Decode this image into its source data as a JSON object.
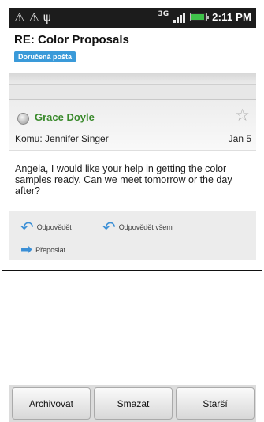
{
  "status_bar": {
    "left_icons": [
      "warning-icon",
      "warning-icon",
      "usb-icon"
    ],
    "network": "3G",
    "time": "2:11 PM",
    "battery_level": 0.8
  },
  "header": {
    "subject": "RE: Color Proposals",
    "folder": "Doručená pošta"
  },
  "message": {
    "sender": "Grace Doyle",
    "recipient": "Komu: Jennifer Singer",
    "date": "Jan 5",
    "body": "Angela, I would like your help in getting the color samples ready. Can we meet tomorrow or the day after?",
    "starred": false
  },
  "actions": {
    "reply": "Odpovědět",
    "reply_all": "Odpovědět všem",
    "forward": "Přeposlat"
  },
  "bottom_buttons": {
    "archive": "Archivovat",
    "delete": "Smazat",
    "older": "Starší"
  },
  "colors": {
    "sender": "#3a8a2c",
    "badge": "#3a9ad9",
    "action_arrow": "#3b8fd6"
  }
}
